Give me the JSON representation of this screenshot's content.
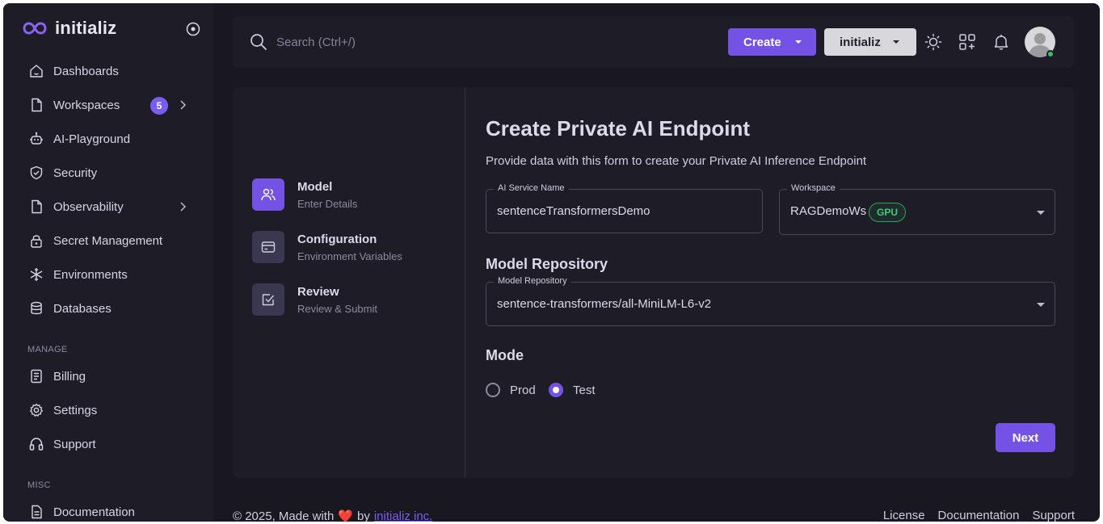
{
  "brand": {
    "name": "initializ"
  },
  "sidebar": {
    "items": [
      {
        "label": "Dashboards",
        "icon": "home-icon"
      },
      {
        "label": "Workspaces",
        "icon": "file-icon",
        "badge": "5"
      },
      {
        "label": "AI-Playground",
        "icon": "robot-icon"
      },
      {
        "label": "Security",
        "icon": "shield-icon"
      },
      {
        "label": "Observability",
        "icon": "file-icon"
      },
      {
        "label": "Secret Management",
        "icon": "lock-icon"
      },
      {
        "label": "Environments",
        "icon": "snowflake-icon"
      },
      {
        "label": "Databases",
        "icon": "database-icon"
      }
    ],
    "manage_label": "MANAGE",
    "manage_items": [
      {
        "label": "Billing",
        "icon": "receipt-icon"
      },
      {
        "label": "Settings",
        "icon": "gear-icon"
      },
      {
        "label": "Support",
        "icon": "headset-icon"
      }
    ],
    "misc_label": "MISC",
    "misc_items": [
      {
        "label": "Documentation",
        "icon": "document-icon"
      }
    ]
  },
  "topbar": {
    "search_placeholder": "Search (Ctrl+/)",
    "create_label": "Create",
    "org_label": "initializ"
  },
  "steps": [
    {
      "title": "Model",
      "subtitle": "Enter Details",
      "active": true
    },
    {
      "title": "Configuration",
      "subtitle": "Environment Variables",
      "active": false
    },
    {
      "title": "Review",
      "subtitle": "Review & Submit",
      "active": false
    }
  ],
  "form": {
    "title": "Create Private AI Endpoint",
    "subtitle": "Provide data with this form to create your Private AI Inference Endpoint",
    "service_name_label": "AI Service Name",
    "service_name_value": "sentenceTransformersDemo",
    "workspace_label": "Workspace",
    "workspace_value": "RAGDemoWs",
    "workspace_chip": "GPU",
    "repo_section": "Model Repository",
    "repo_label": "Model Repository",
    "repo_value": "sentence-transformers/all-MiniLM-L6-v2",
    "mode_section": "Mode",
    "mode_options": [
      "Prod",
      "Test"
    ],
    "mode_selected": "Test",
    "next_label": "Next"
  },
  "footer": {
    "copyright": "© 2025, Made with",
    "by": "by",
    "company": "initializ inc.",
    "links": [
      "License",
      "Documentation",
      "Support"
    ]
  },
  "colors": {
    "accent": "#7552e6",
    "badge": "#7b5cf0",
    "online": "#2dc26b",
    "gpu_chip": "#3ccd78"
  }
}
